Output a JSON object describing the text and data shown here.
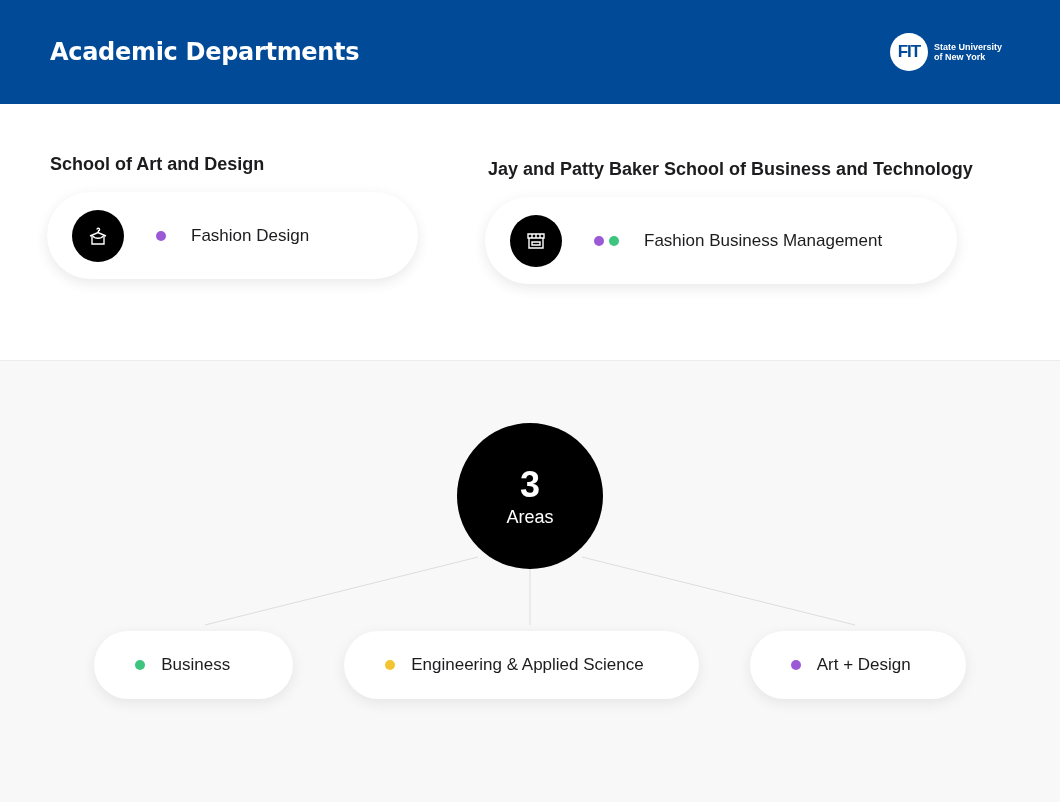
{
  "header": {
    "title": "Academic Departments",
    "logo": {
      "mark": "FIT",
      "lines": [
        "State University",
        "of New York"
      ]
    }
  },
  "schools": [
    {
      "name": "School of Art and Design",
      "program": {
        "kind": "hanger",
        "label": "Fashion Design",
        "dots": [
          {
            "color": "#9b59d6"
          }
        ]
      }
    },
    {
      "name": "Jay and Patty Baker School of Business and Technology",
      "program": {
        "kind": "store",
        "label": "Fashion Business Management",
        "dots": [
          {
            "color": "#9b59d6"
          },
          {
            "color": "#3dc47e"
          }
        ]
      }
    }
  ],
  "summary": {
    "count": "3",
    "label": "Areas"
  },
  "areas": [
    {
      "label": "Business",
      "color": "#3dc47e"
    },
    {
      "label": "Engineering & Applied Science",
      "color": "#f4c430"
    },
    {
      "label": "Art + Design",
      "color": "#9b59d6"
    }
  ]
}
